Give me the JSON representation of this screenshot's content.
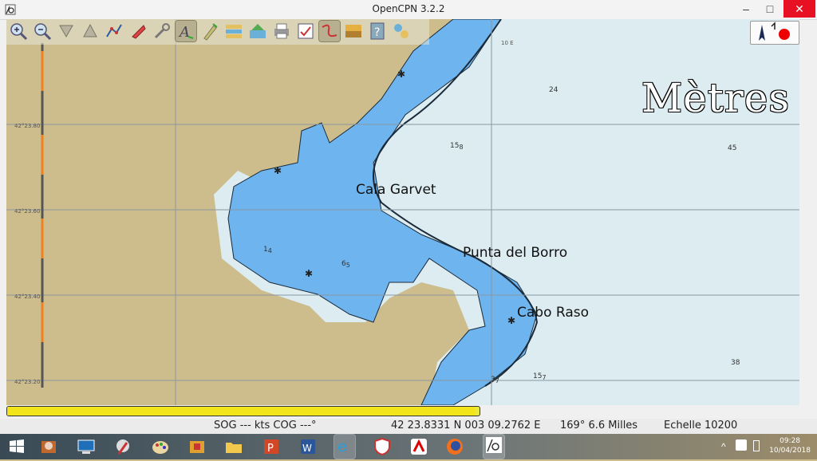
{
  "window": {
    "title": "OpenCPN 3.2.2",
    "minimize": "–",
    "maximize": "□",
    "close": "✕"
  },
  "toolbar": {
    "icons": [
      "zoom-in-icon",
      "zoom-out-icon",
      "scale-in-icon",
      "scale-out-icon",
      "route-icon",
      "ship-icon",
      "tools-icon",
      "text-icon",
      "tide-icon",
      "chart-quilt-icon",
      "layers-icon",
      "print-icon",
      "settings-icon",
      "track-icon",
      "color-scheme-icon",
      "help-icon",
      "info-icon"
    ]
  },
  "chart": {
    "units_label": "Mètres",
    "lon_label": "10 E",
    "latitudes": [
      "42°23.80",
      "42°23.60",
      "42°23.40",
      "42°23.20"
    ],
    "places": {
      "cala_garvet": "Cala Garvet",
      "punta_del_borro": "Punta del Borro",
      "cabo_raso": "Cabo Raso"
    },
    "depths": [
      {
        "main": "24",
        "sub": ""
      },
      {
        "main": "15",
        "sub": "8"
      },
      {
        "main": "45",
        "sub": ""
      },
      {
        "main": "1",
        "sub": "4"
      },
      {
        "main": "6",
        "sub": "5"
      },
      {
        "main": "38",
        "sub": ""
      },
      {
        "main": "15",
        "sub": "7"
      },
      {
        "main": "3",
        "sub": "7"
      }
    ],
    "colors": {
      "land": "#cdbd8d",
      "shallow": "#6eb4ee",
      "deep": "#dcecf0"
    }
  },
  "progress": {
    "fraction": 0.99,
    "color": "#f2e51a"
  },
  "status": {
    "sog_cog": "SOG --- kts  COG ---°",
    "position": "42 23.8331 N   003 09.2762 E",
    "bearing_dist": "169°  6.6 Milles",
    "scale": "Echelle 10200"
  },
  "taskbar": {
    "apps": [
      "start-icon",
      "explorer-icon",
      "remote-desktop-icon",
      "paint-brush-icon",
      "palette-icon",
      "package-icon",
      "folder-icon",
      "powerpoint-icon",
      "word-icon",
      "internet-explorer-icon",
      "shield-icon",
      "avira-icon",
      "firefox-icon",
      "opencpn-icon"
    ],
    "time": "09:28",
    "date": "10/04/2018"
  }
}
